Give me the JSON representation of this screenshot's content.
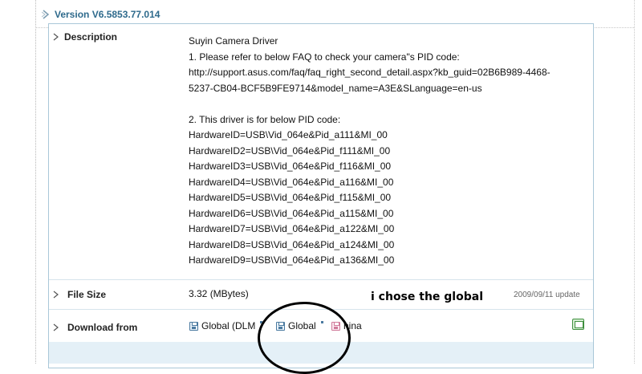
{
  "version": {
    "label": "Version V6.5853.77.014"
  },
  "description": {
    "label": "Description",
    "lines": [
      "Suyin Camera Driver",
      "1. Please refer to below FAQ to check your camera\"s PID code:",
      "http://support.asus.com/faq/faq_right_second_detail.aspx?kb_guid=02B6B989-4468-",
      "5237-CB04-BCF5B9FE9714&model_name=A3E&SLanguage=en-us",
      "",
      "2. This driver is for below PID code:",
      "HardwareID=USB\\Vid_064e&Pid_a111&MI_00",
      "HardwareID2=USB\\Vid_064e&Pid_f111&MI_00",
      "HardwareID3=USB\\Vid_064e&Pid_f116&MI_00",
      "HardwareID4=USB\\Vid_064e&Pid_a116&MI_00",
      "HardwareID5=USB\\Vid_064e&Pid_f115&MI_00",
      "HardwareID6=USB\\Vid_064e&Pid_a115&MI_00",
      "HardwareID7=USB\\Vid_064e&Pid_a122&MI_00",
      "HardwareID8=USB\\Vid_064e&Pid_a124&MI_00",
      "HardwareID9=USB\\Vid_064e&Pid_a136&MI_00"
    ]
  },
  "file_size": {
    "label": "File Size",
    "value": "3.32 (MBytes)",
    "update": "2009/09/11 update"
  },
  "annotation": "i chose the global",
  "download": {
    "label": "Download from",
    "sources": [
      {
        "label": "Global (DLM",
        "icon": "floppy-disk-icon"
      },
      {
        "label": "Global",
        "icon": "floppy-disk-icon"
      },
      {
        "label": "hina",
        "icon": "floppy-disk-pink-icon"
      }
    ]
  },
  "colors": {
    "version_text": "#2e6a8c",
    "panel_border": "#a9c7d8",
    "bottom_band": "#e4f0f7"
  }
}
